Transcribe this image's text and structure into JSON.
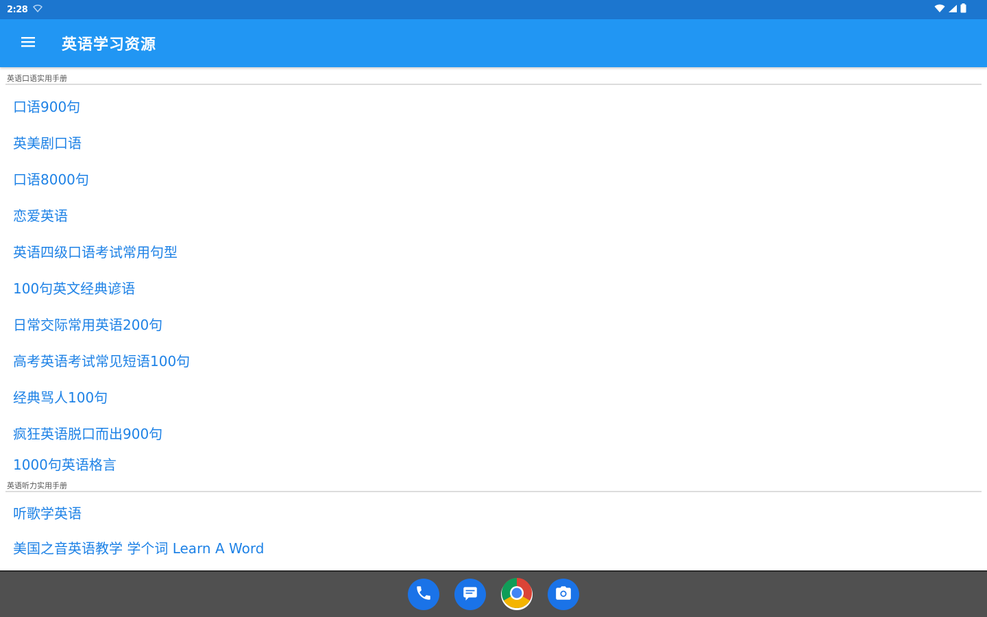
{
  "status_bar": {
    "time": "2:28"
  },
  "app_bar": {
    "title": "英语学习资源"
  },
  "sections": [
    {
      "header": "英语口语实用手册",
      "items": [
        "口语900句",
        "英美剧口语",
        "口语8000句",
        "恋爱英语",
        "英语四级口语考试常用句型",
        "100句英文经典谚语",
        "日常交际常用英语200句",
        "高考英语考试常见短语100句",
        "经典骂人100句",
        "疯狂英语脱口而出900句",
        "1000句英语格言"
      ]
    },
    {
      "header": "英语听力实用手册",
      "items": [
        "听歌学英语",
        "美国之音英语教学 学个词 Learn A Word"
      ]
    }
  ],
  "dock": [
    "phone-icon",
    "messages-icon",
    "chrome-icon",
    "camera-icon"
  ],
  "colors": {
    "status_bar": "#1c76cf",
    "app_bar": "#2196f3",
    "link_text": "#1e82e6",
    "nav_bar": "#505050"
  }
}
